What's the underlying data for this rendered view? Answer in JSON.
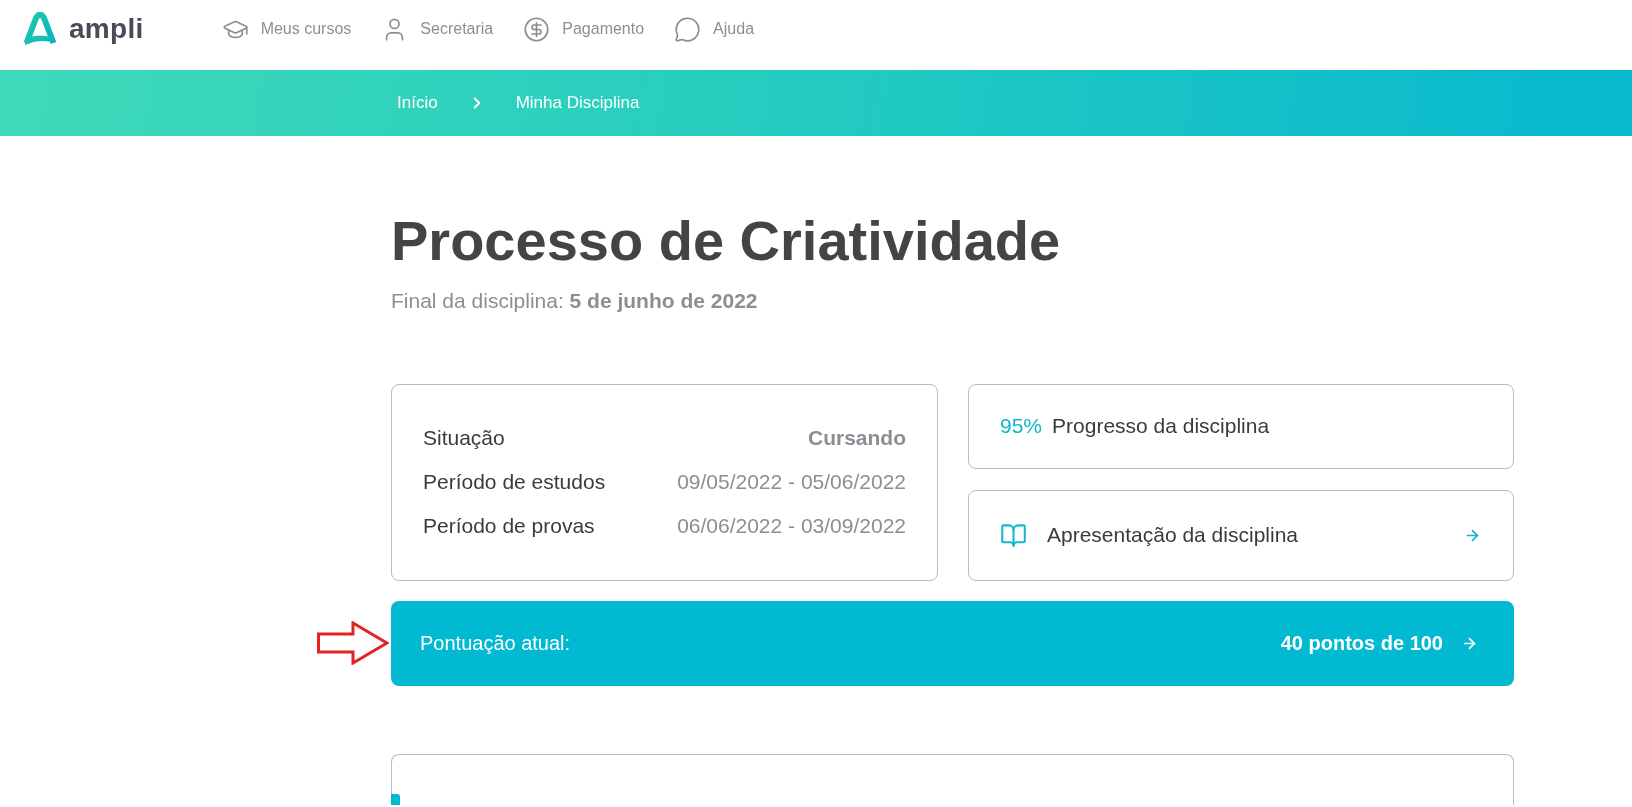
{
  "header": {
    "logo": {
      "text": "ampli"
    },
    "nav": [
      {
        "label": "Meus cursos"
      },
      {
        "label": "Secretaria"
      },
      {
        "label": "Pagamento"
      },
      {
        "label": "Ajuda"
      }
    ]
  },
  "breadcrumb": [
    {
      "label": "Início"
    },
    {
      "label": "Minha Disciplina"
    }
  ],
  "course": {
    "title": "Processo de Criatividade",
    "end_date": "Final da disciplina: **5 de junho de 2022**"
  },
  "summary": {
    "rows": [
      {
        "kind": "status",
        "label": "Situação",
        "value": "Cursando"
      },
      {
        "kind": "period",
        "label": "Período de estudos",
        "value": "09/05/2022 - 05/06/2022"
      },
      {
        "kind": "period",
        "label": "Período de provas",
        "value": "06/06/2022 - 03/09/2022"
      }
    ]
  },
  "progress": {
    "percent": "95%",
    "label": "Progresso da disciplina"
  },
  "presentation_link": {
    "label": "Apresentação da disciplina"
  },
  "score": {
    "label": "Pontuação atual:",
    "value": "40 pontos de 100"
  },
  "annotation": {
    "kind": "arrow"
  }
}
